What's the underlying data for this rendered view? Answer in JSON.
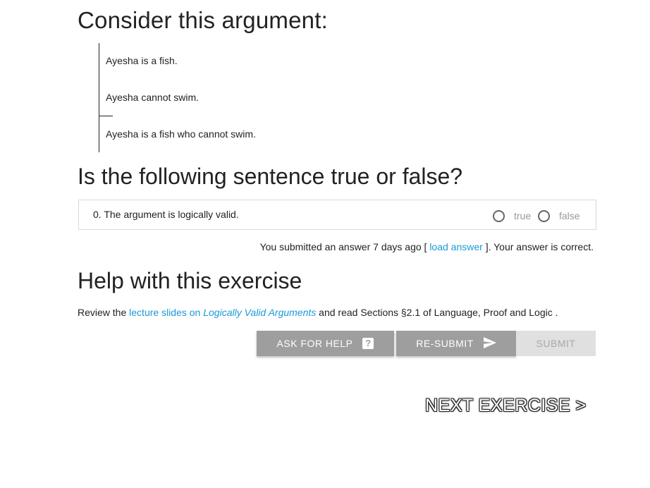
{
  "argument": {
    "heading": "Consider this argument:",
    "premises": [
      "Ayesha is a fish.",
      "Ayesha cannot swim."
    ],
    "conclusion": "Ayesha is a fish who cannot swim."
  },
  "question": {
    "heading": "Is the following sentence true or false?",
    "statement": "0. The argument is logically valid.",
    "option_true": "true",
    "option_false": "false"
  },
  "submission": {
    "prefix": "You submitted an answer 7 days ago [",
    "link": "load answer",
    "suffix": "]. Your answer is correct."
  },
  "help": {
    "heading": "Help with this exercise",
    "review_prefix": "Review the",
    "review_link_prefix": "lecture slides on",
    "review_link_italic": "Logically Valid Arguments",
    "review_suffix": "and read Sections §2.1 of Language, Proof and Logic ."
  },
  "buttons": {
    "ask_for_help": "ASK FOR HELP",
    "ask_for_help_icon": "?",
    "resubmit": "RE-SUBMIT",
    "submit": "SUBMIT"
  },
  "next": {
    "label": "NEXT EXERCISE >"
  },
  "colors": {
    "link": "#1a9ad6",
    "button": "#9e9e9e",
    "button_disabled": "#e0e0e0"
  }
}
